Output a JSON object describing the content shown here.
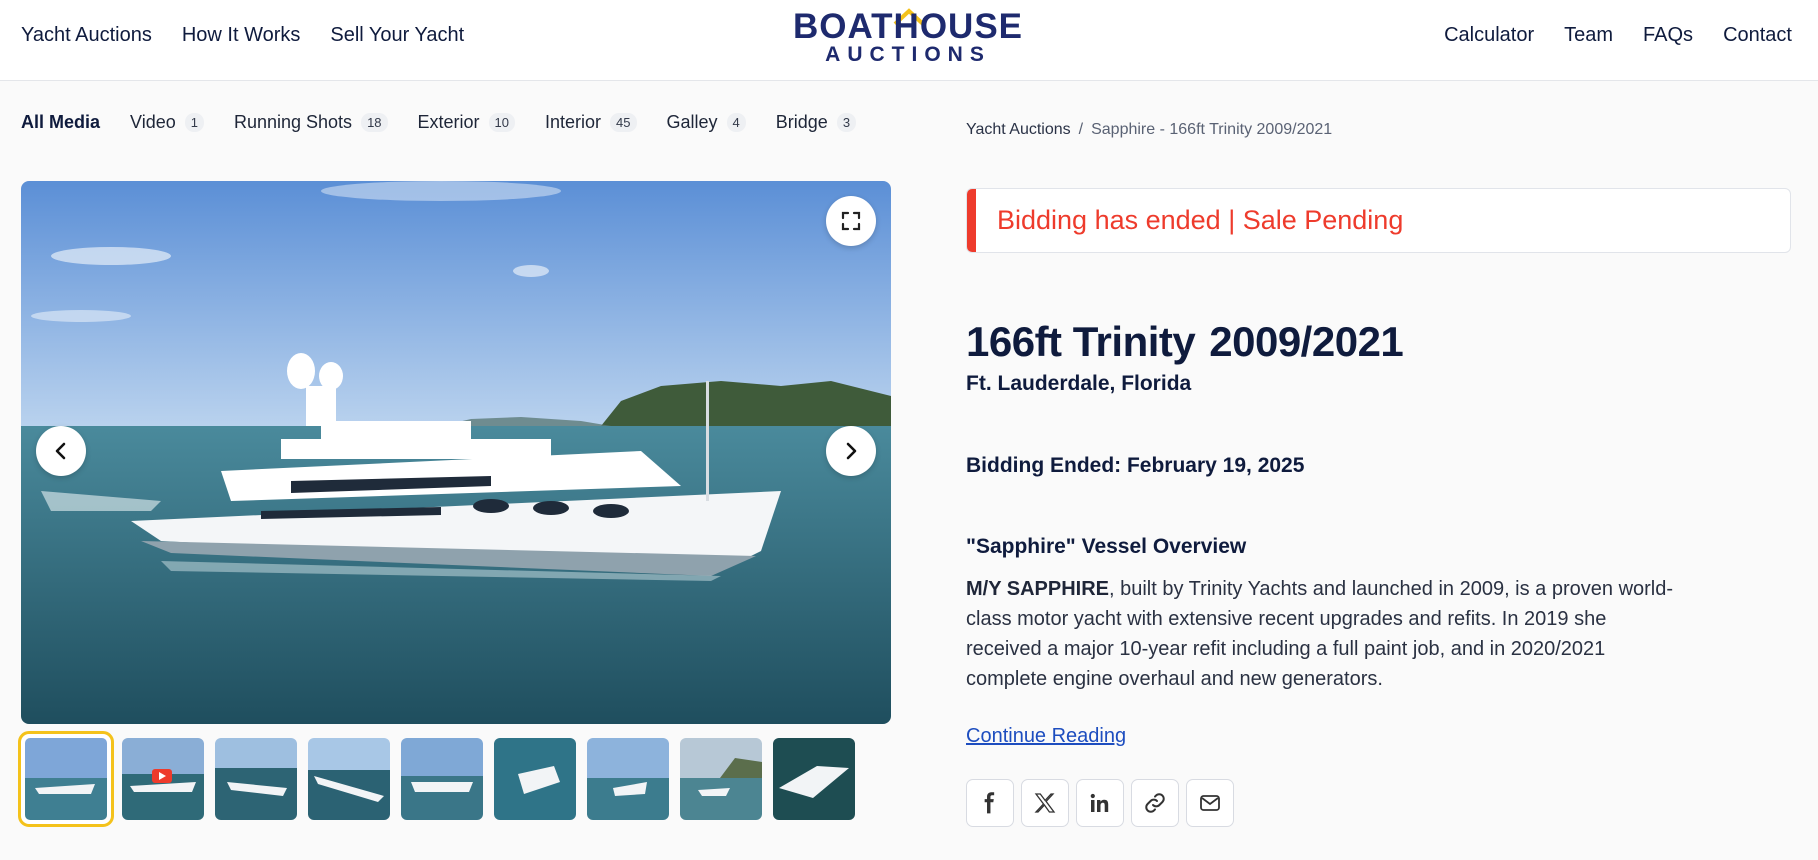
{
  "nav": {
    "left": [
      "Yacht Auctions",
      "How It Works",
      "Sell Your Yacht"
    ],
    "right": [
      "Calculator",
      "Team",
      "FAQs",
      "Contact"
    ]
  },
  "logo": {
    "top": "BOATHOUSE",
    "bottom": "AUCTIONS"
  },
  "media_tabs": [
    {
      "label": "All Media",
      "count": null,
      "active": true
    },
    {
      "label": "Video",
      "count": "1"
    },
    {
      "label": "Running Shots",
      "count": "18"
    },
    {
      "label": "Exterior",
      "count": "10"
    },
    {
      "label": "Interior",
      "count": "45"
    },
    {
      "label": "Galley",
      "count": "4"
    },
    {
      "label": "Bridge",
      "count": "3"
    }
  ],
  "breadcrumb": {
    "link": "Yacht Auctions",
    "separator": "/",
    "current": "Sapphire - 166ft Trinity 2009/2021"
  },
  "status": {
    "text": "Bidding has ended | Sale Pending",
    "color": "#ee3b2c"
  },
  "listing": {
    "title": "166ft Trinity",
    "year": "2009/2021",
    "location": "Ft. Lauderdale, Florida",
    "bidding_ended": "Bidding Ended: February 19, 2025"
  },
  "overview": {
    "heading": "\"Sapphire\" Vessel Overview",
    "lead": "M/Y SAPPHIRE",
    "body": ", built by Trinity Yachts and launched in 2009, is a proven world-class motor yacht with extensive recent upgrades and refits. In 2019 she received a major 10-year refit including a full paint job, and in 2020/2021 complete engine overhaul and new generators.",
    "continue_label": "Continue Reading"
  },
  "share_icons": [
    "facebook-icon",
    "x-icon",
    "linkedin-icon",
    "link-icon",
    "email-icon"
  ],
  "colors": {
    "brand": "#1e2a6e",
    "accent": "#f4c21b",
    "alert": "#ee3b2c",
    "link": "#1d4dbf"
  }
}
